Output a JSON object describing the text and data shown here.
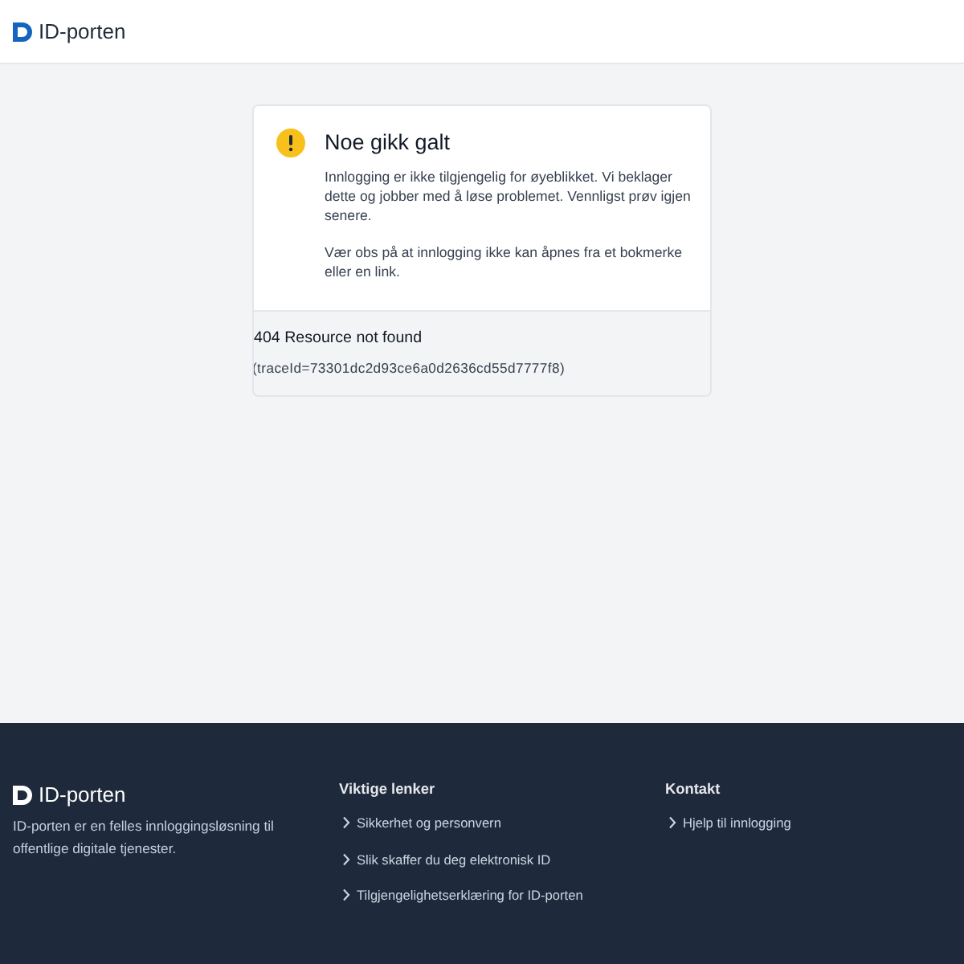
{
  "header": {
    "logo_text": "ID-porten"
  },
  "error_card": {
    "title": "Noe gikk galt",
    "paragraphs": [
      "Innlogging er ikke tilgjengelig for øyeblikket. Vi beklager dette og jobber med å løse problemet. Vennligst prøv igjen senere.",
      "Vær obs på at innlogging ikke kan åpnes fra et bokmerke eller en link."
    ],
    "status": "404 Resource not found",
    "trace": "(traceId=73301dc2d93ce6a0d2636cd55d7777f8)"
  },
  "footer": {
    "logo_text": "ID-porten",
    "description": "ID-porten er en felles innloggingsløsning til offentlige digitale tjenester.",
    "columns": [
      {
        "heading": "Viktige lenker",
        "links": [
          "Sikkerhet og personvern",
          "Slik skaffer du deg elektronisk ID",
          "Tilgjengelighetserklæring for ID-porten"
        ]
      },
      {
        "heading": "Kontakt",
        "links": [
          "Hjelp til innlogging"
        ]
      }
    ]
  }
}
